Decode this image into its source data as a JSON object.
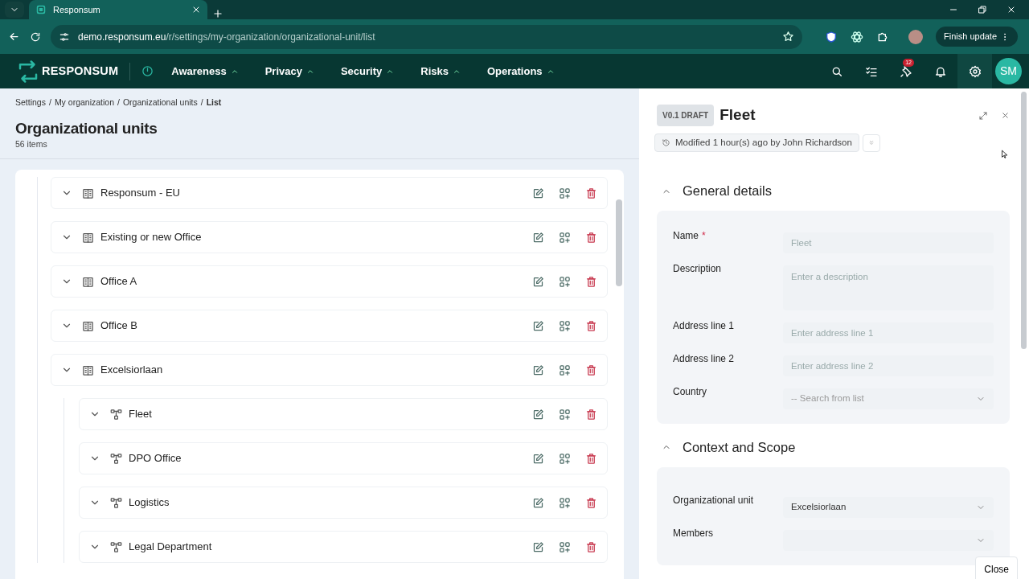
{
  "browser": {
    "tab_title": "Responsum",
    "url_host": "demo.responsum.eu",
    "url_path": "/r/settings/my-organization/organizational-unit/list",
    "update_button": "Finish update"
  },
  "app_nav": {
    "logo": "RESPONSUM",
    "menus": [
      {
        "label": "Awareness"
      },
      {
        "label": "Privacy"
      },
      {
        "label": "Security"
      },
      {
        "label": "Risks"
      },
      {
        "label": "Operations"
      }
    ],
    "notification_count": "12",
    "avatar": "SM"
  },
  "breadcrumb": [
    {
      "label": "Settings",
      "current": false
    },
    {
      "separator": "/",
      "label": "My organization",
      "current": false
    },
    {
      "separator": "/",
      "label": "Organizational units",
      "current": false
    },
    {
      "separator": "/",
      "label": "List",
      "current": true
    }
  ],
  "page": {
    "title": "Organizational units",
    "count": "56 items"
  },
  "tree": [
    {
      "label": "Responsum - EU",
      "kind": "office"
    },
    {
      "label": "Existing or new Office",
      "kind": "office"
    },
    {
      "label": "Office A",
      "kind": "office"
    },
    {
      "label": "Office B",
      "kind": "office"
    },
    {
      "label": "Excelsiorlaan",
      "kind": "office",
      "children": [
        {
          "label": "Fleet",
          "kind": "department"
        },
        {
          "label": "DPO Office",
          "kind": "department"
        },
        {
          "label": "Logistics",
          "kind": "department"
        },
        {
          "label": "Legal Department",
          "kind": "department"
        }
      ]
    }
  ],
  "panel": {
    "version": "V0.1 DRAFT",
    "title": "Fleet",
    "modified": "Modified 1 hour(s) ago by John Richardson",
    "sections": [
      {
        "title": "General details",
        "expanded": true,
        "fields": [
          {
            "label": "Name",
            "required_mark": "*",
            "kind": "text",
            "placeholder": "Fleet"
          },
          {
            "label": "Description",
            "kind": "textarea",
            "placeholder": "Enter a description"
          },
          {
            "label": "Address line 1",
            "kind": "text",
            "placeholder": "Enter address line 1"
          },
          {
            "label": "Address line 2",
            "kind": "text",
            "placeholder": "Enter address line 2"
          },
          {
            "label": "Country",
            "kind": "select",
            "placeholder": "-- Search from list"
          }
        ]
      },
      {
        "title": "Context and Scope",
        "expanded": true,
        "fields": [
          {
            "label": "Organizational unit",
            "kind": "select",
            "value": "Excelsiorlaan"
          },
          {
            "label": "Members",
            "kind": "select"
          }
        ]
      }
    ],
    "close_button": "Close"
  }
}
